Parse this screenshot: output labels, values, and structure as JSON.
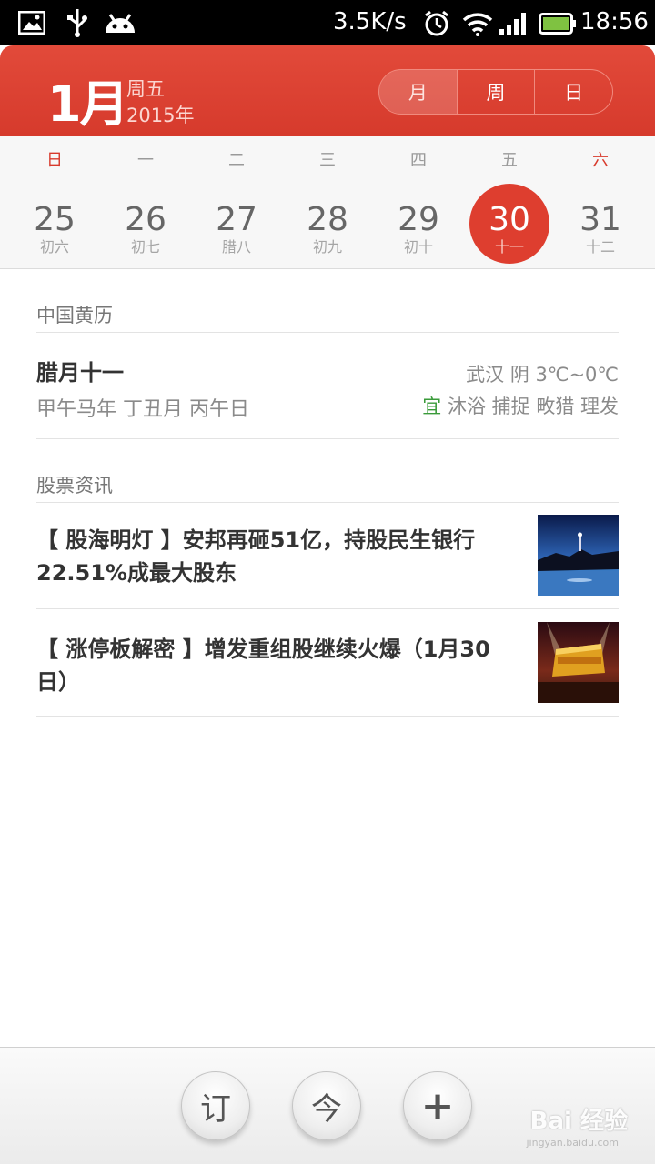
{
  "status_bar": {
    "net_speed": "3.5K/s",
    "time": "18:56",
    "icons": [
      "gallery-icon",
      "usb-icon",
      "android-icon",
      "alarm-icon",
      "wifi-icon",
      "signal-icon",
      "battery-icon"
    ]
  },
  "header": {
    "month": "1月",
    "weekday": "周五",
    "year": "2015年",
    "view_tabs": [
      "月",
      "周",
      "日"
    ],
    "active_tab": "月",
    "accent": "#dc3f30"
  },
  "week": {
    "weekdays": [
      "日",
      "一",
      "二",
      "三",
      "四",
      "五",
      "六"
    ],
    "days": [
      {
        "num": "25",
        "lunar": "初六"
      },
      {
        "num": "26",
        "lunar": "初七"
      },
      {
        "num": "27",
        "lunar": "腊八"
      },
      {
        "num": "28",
        "lunar": "初九"
      },
      {
        "num": "29",
        "lunar": "初十"
      },
      {
        "num": "30",
        "lunar": "十一"
      },
      {
        "num": "31",
        "lunar": "十二"
      }
    ],
    "selected": "30"
  },
  "almanac": {
    "section_title": "中国黄历",
    "lunar_date": "腊月十一",
    "ganzhi": "甲午马年 丁丑月 丙午日",
    "weather": "武汉  阴  3℃~0℃",
    "yi_label": "宜",
    "yi_items": "沐浴 捕捉 畋猎 理发"
  },
  "stocks": {
    "section_title": "股票资讯",
    "items": [
      {
        "title": "【 股海明灯 】安邦再砸51亿，持股民生银行22.51%成最大股东"
      },
      {
        "title": "【 涨停板解密 】增发重组股继续火爆（1月30日）"
      }
    ]
  },
  "bottom_bar": {
    "subscribe_label": "订",
    "today_label": "今",
    "add_label": "+"
  },
  "watermark": {
    "brand": "Bai 经验",
    "url": "jingyan.baidu.com"
  }
}
